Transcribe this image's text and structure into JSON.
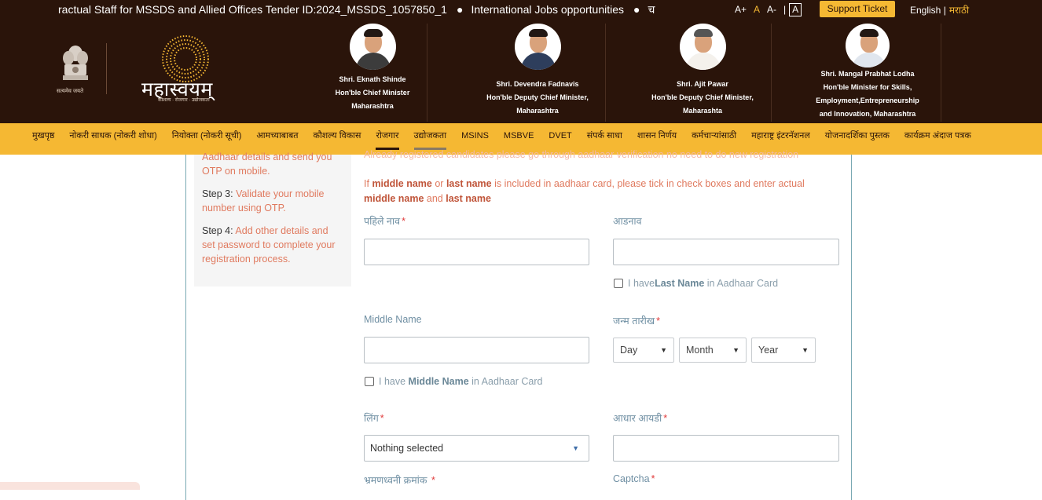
{
  "header": {
    "ticker_1": "ractual Staff for MSSDS and Allied Offices Tender ID:2024_MSSDS_1057850_1",
    "ticker_2": "International Jobs opportunities",
    "ticker_3": "च",
    "font_sizes": [
      "A+",
      "A",
      "A-",
      "A"
    ],
    "support_label": "Support Ticket",
    "lang_en": "English |",
    "lang_mr": "मराठी",
    "emblem_caption": "सत्यमेव जयते",
    "brand_name": "महास्वयम्",
    "brand_tagline": "कौशल्य · रोजगार · उद्योजकता",
    "leaders": [
      {
        "name": "Shri. Eknath Shinde",
        "role": "Hon'ble Chief Minister",
        "state": "Maharashtra"
      },
      {
        "name": "Shri. Devendra Fadnavis",
        "role": "Hon'ble Deputy Chief Minister,",
        "state": "Maharashtra"
      },
      {
        "name": "Shri. Ajit Pawar",
        "role": "Hon'ble Deputy Chief Minister,",
        "state": "Maharashta"
      },
      {
        "name": "Shri. Mangal Prabhat Lodha",
        "role": "Hon'ble Minister for Skills,",
        "role2": "Employment,Entrepreneurship",
        "state": "and Innovation, Maharashtra"
      }
    ]
  },
  "nav": {
    "items": [
      "मुखपृष्ठ",
      "नोकरी साधक (नोकरी शोधा)",
      "नियोक्ता (नोकरी सूची)",
      "आमच्याबाबत",
      "कौशल्य विकास",
      "रोजगार",
      "उद्योजकता",
      "MSINS",
      "MSBVE",
      "DVET",
      "संपर्क साधा",
      "शासन निर्णय",
      "कर्मचाऱ्यांसाठी",
      "महाराष्ट्र इंटरनॅशनल",
      "योजनादर्शिका पुस्तक",
      "कार्यक्रम अंदाज पत्रक"
    ]
  },
  "steps": {
    "step2_tail": "Aadhaar details and send you OTP on mobile.",
    "step3_label": "Step 3:",
    "step3_text": "Validate your mobile number using OTP.",
    "step4_label": "Step 4:",
    "step4_text": "Add other details and set password to complete your registration process."
  },
  "form": {
    "note_cut": "Already registered candidates please go through aadhaar verification no need to do new registration",
    "note_if": "If",
    "note_middle": "middle name",
    "note_or": "or",
    "note_last": "last name",
    "note_rest": "is included in aadhaar card, please tick in check boxes and enter actual",
    "note_and": "and",
    "first_name_label": "पहिले नाव",
    "surname_label": "आडनाव",
    "last_name_chk_pre": "I have",
    "last_name_chk_bold": "Last Name",
    "last_name_chk_post": "in Aadhaar Card",
    "middle_name_label": "Middle Name",
    "middle_name_chk_pre": "I have",
    "middle_name_chk_bold": "Middle Name",
    "middle_name_chk_post": "in Aadhaar Card",
    "dob_label": "जन्म तारीख",
    "dob_day": "Day",
    "dob_month": "Month",
    "dob_year": "Year",
    "gender_label": "लिंग",
    "gender_value": "Nothing selected",
    "aadhaar_label": "आधार आयडी",
    "mobile_label": "भ्रमणध्वनी क्रमांक",
    "captcha_label": "Captcha",
    "required_mark": "*"
  }
}
